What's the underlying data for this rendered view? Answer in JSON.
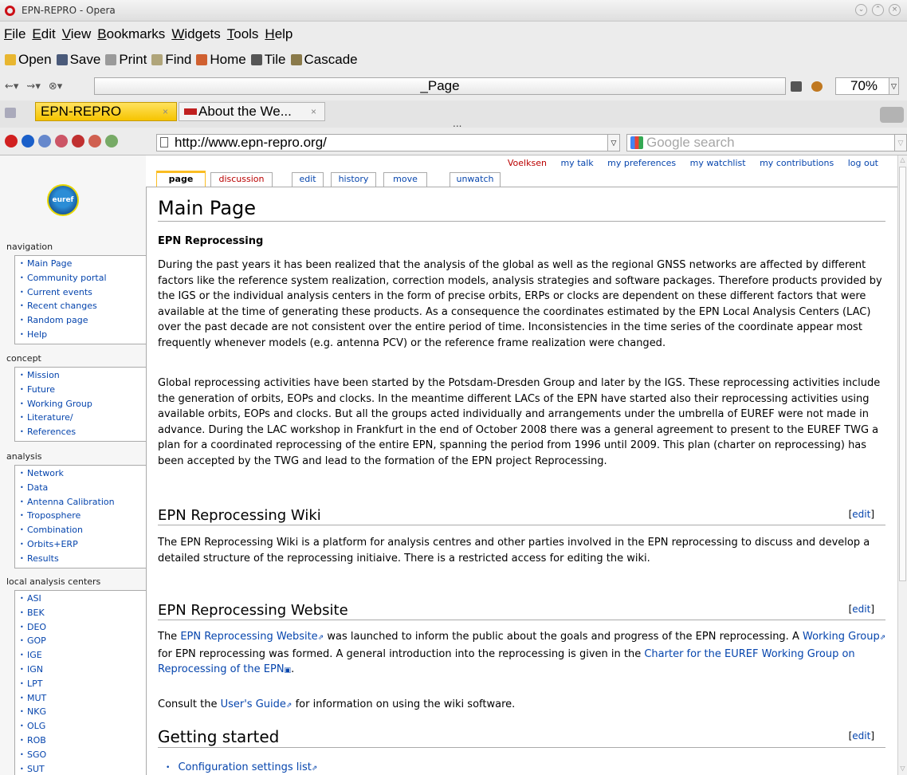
{
  "window": {
    "title": "EPN-REPRO - Opera"
  },
  "menu": [
    "File",
    "Edit",
    "View",
    "Bookmarks",
    "Widgets",
    "Tools",
    "Help"
  ],
  "toolbar": [
    "Open",
    "Save",
    "Print",
    "Find",
    "Home",
    "Tile",
    "Cascade"
  ],
  "pagebar": {
    "label": "_Page",
    "zoom": "70%"
  },
  "tabs": [
    {
      "label": "EPN-REPRO"
    },
    {
      "label": "About the We..."
    }
  ],
  "tab_overflow": "...",
  "address": {
    "url": "http://www.epn-repro.org/",
    "search_placeholder": "Google search"
  },
  "personal": [
    "Voelksen",
    "my talk",
    "my preferences",
    "my watchlist",
    "my contributions",
    "log out"
  ],
  "logo_text": "euref",
  "content_tabs": [
    "page",
    "discussion",
    "edit",
    "history",
    "move",
    "unwatch"
  ],
  "sidebar": {
    "navigation": {
      "title": "navigation",
      "items": [
        "Main Page",
        "Community portal",
        "Current events",
        "Recent changes",
        "Random page",
        "Help"
      ]
    },
    "concept": {
      "title": "concept",
      "items": [
        "Mission",
        "Future",
        "Working Group",
        "Literature/",
        "References"
      ]
    },
    "analysis": {
      "title": "analysis",
      "items": [
        "Network",
        "Data",
        "Antenna Calibration",
        "Troposphere",
        "Combination",
        "Orbits+ERP",
        "Results"
      ]
    },
    "lac": {
      "title": "local analysis centers",
      "items": [
        "ASI",
        "BEK",
        "DEO",
        "GOP",
        "IGE",
        "IGN",
        "LPT",
        "MUT",
        "NKG",
        "OLG",
        "ROB",
        "SGO",
        "SUT"
      ]
    }
  },
  "article": {
    "title": "Main Page",
    "subtitle": "EPN Reprocessing",
    "para1": "During the past years it has been realized that the analysis of the global as well as the regional GNSS networks are affected by different factors like the reference system realization, correction models, analysis strategies and software packages. Therefore products provided by the IGS or the individual analysis centers in the form of precise orbits, ERPs or clocks are dependent on these different factors that were available at the time of generating these products. As a consequence the coordinates estimated by the EPN Local Analysis Centers (LAC) over the past decade are not consistent over the entire period of time. Inconsistencies in the time series of the coordinate appear most frequently whenever models (e.g. antenna PCV) or the reference frame realization were changed.",
    "para2": "Global reprocessing activities have been started by the Potsdam-Dresden Group and later by the IGS. These reprocessing activities include the generation of orbits, EOPs and clocks. In the meantime different LACs of the EPN have started also their reprocessing activities using available orbits, EOPs and clocks. But all the groups acted individually and arrangements under the umbrella of EUREF were not made in advance. During the LAC workshop in Frankfurt in the end of October 2008 there was a general agreement to present to the EUREF TWG a plan for a coordinated reprocessing of the entire EPN, spanning the period from 1996 until 2009. This plan (charter on reprocessing) has been accepted by the TWG and lead to the formation of the EPN project Reprocessing.",
    "edit_label": "edit",
    "sec_wiki": {
      "title": "EPN Reprocessing Wiki",
      "text": "The EPN Reprocessing Wiki is a platform for analysis centres and other parties involved in the EPN reprocessing to discuss and develop a detailed structure of the reprocessing initiaive. There is a restricted access for editing the wiki."
    },
    "sec_website": {
      "title": "EPN Reprocessing Website",
      "t1": "The ",
      "link1": "EPN Reprocessing Website",
      "t2": " was launched to inform the public about the goals and progress of the EPN reprocessing. A ",
      "link2": "Working Group",
      "t3": " for EPN reprocessing was formed. A general introduction into the reprocessing is given in the ",
      "link3": "Charter for the EUREF Working Group on Reprocessing of the EPN",
      "t4": ".",
      "consult1": "Consult the ",
      "consult_link": "User's Guide",
      "consult2": " for information on using the wiki software."
    },
    "sec_start": {
      "title": "Getting started",
      "item1": "Configuration settings list"
    }
  }
}
